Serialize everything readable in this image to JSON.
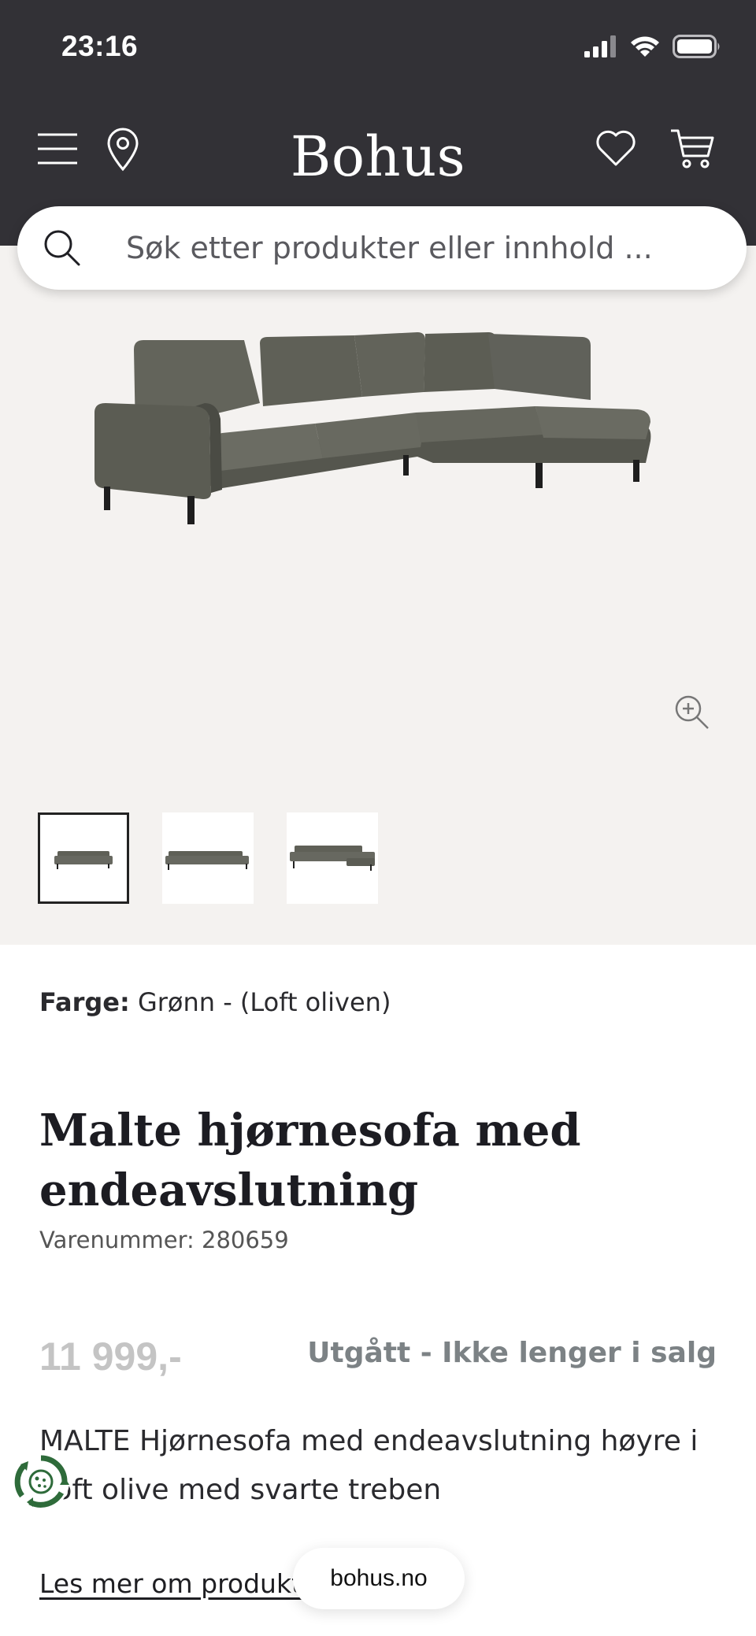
{
  "status_bar": {
    "time": "23:16",
    "icons": [
      "signal-icon",
      "wifi-icon",
      "battery-icon"
    ]
  },
  "header": {
    "logo": "Bohus",
    "left_icons": [
      "menu-icon",
      "location-pin-icon"
    ],
    "right_icons": [
      "heart-icon",
      "cart-icon"
    ]
  },
  "search": {
    "placeholder": "Søk etter produkter eller innhold ..."
  },
  "gallery": {
    "thumbnails": [
      {
        "label": "Sofa view 1",
        "selected": true
      },
      {
        "label": "Sofa view 2",
        "selected": false
      },
      {
        "label": "Sofa view 3",
        "selected": false
      }
    ]
  },
  "product": {
    "color_label": "Farge:",
    "color_value": "Grønn - (Loft oliven)",
    "title": "Malte hjørnesofa med endeavslutning",
    "sku": "Varenummer: 280659",
    "price": "11 999,-",
    "availability": "Utgått - Ikke lenger i salg",
    "description": "MALTE Hjørnesofa med endeavslutning høyre i Loft olive med svarte treben",
    "read_more": "Les mer om produktet"
  },
  "browser": {
    "url": "bohus.no"
  },
  "colors": {
    "header_bg": "#323136",
    "gallery_bg": "#f4f2f0",
    "sofa": "#5d5e55",
    "price_disabled": "#c4c4c4",
    "status_grey": "#7c8285",
    "cookie_green": "#2e6b3a"
  }
}
